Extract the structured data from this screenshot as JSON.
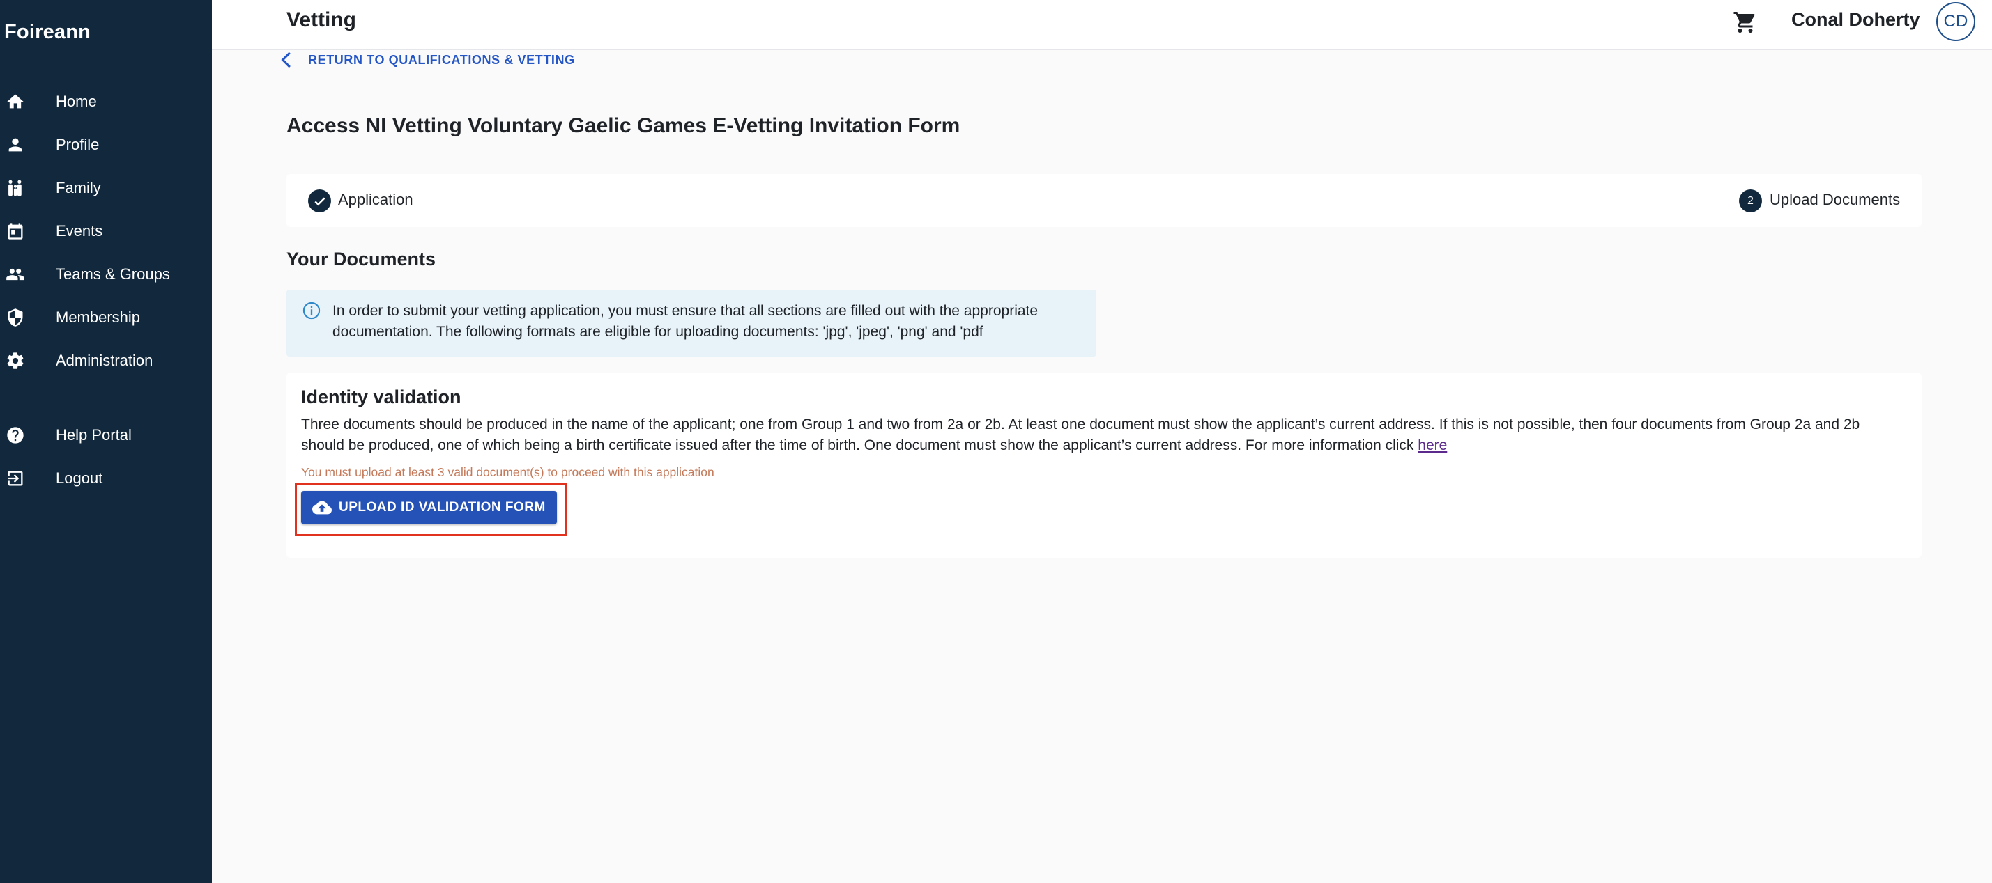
{
  "app": {
    "brand": "Foireann"
  },
  "sidebar": {
    "items": [
      {
        "label": "Home",
        "icon": "home-icon"
      },
      {
        "label": "Profile",
        "icon": "person-icon"
      },
      {
        "label": "Family",
        "icon": "family-icon"
      },
      {
        "label": "Events",
        "icon": "calendar-icon"
      },
      {
        "label": "Teams & Groups",
        "icon": "group-icon"
      },
      {
        "label": "Membership",
        "icon": "shield-icon"
      },
      {
        "label": "Administration",
        "icon": "gear-icon"
      }
    ],
    "secondary": [
      {
        "label": "Help Portal",
        "icon": "help-icon"
      },
      {
        "label": "Logout",
        "icon": "logout-icon"
      }
    ]
  },
  "header": {
    "title": "Vetting",
    "user_name": "Conal Doherty",
    "avatar_initials": "CD"
  },
  "main": {
    "back_label": "RETURN TO QUALIFICATIONS & VETTING",
    "form_title": "Access NI Vetting Voluntary Gaelic Games E-Vetting Invitation Form",
    "stepper": {
      "step1_label": "Application",
      "step2_number": "2",
      "step2_label": "Upload Documents"
    },
    "section_title": "Your Documents",
    "info_text": "In order to submit your vetting application, you must ensure that all sections are filled out with the appropriate documentation. The following formats are eligible for uploading documents: 'jpg', 'jpeg', 'png' and 'pdf",
    "identity": {
      "title": "Identity validation",
      "description": "Three documents should be produced in the name of the applicant; one from Group 1 and two from 2a or 2b. At least one document must show the applicant’s current address. If this is not possible, then four documents from Group 2a and 2b should be produced, one of which being a birth certificate issued after the time of birth. One document must show the applicant’s current address. For more information click ",
      "link_label": "here",
      "warning": "You must upload at least 3 valid document(s) to proceed with this application",
      "upload_label": "UPLOAD ID VALIDATION FORM"
    }
  },
  "colors": {
    "sidebar_bg": "#12293d",
    "accent": "#2452b6",
    "highlight": "#e0321e",
    "info_bg": "#e7f3f9",
    "warning_text": "#c47a5a"
  }
}
